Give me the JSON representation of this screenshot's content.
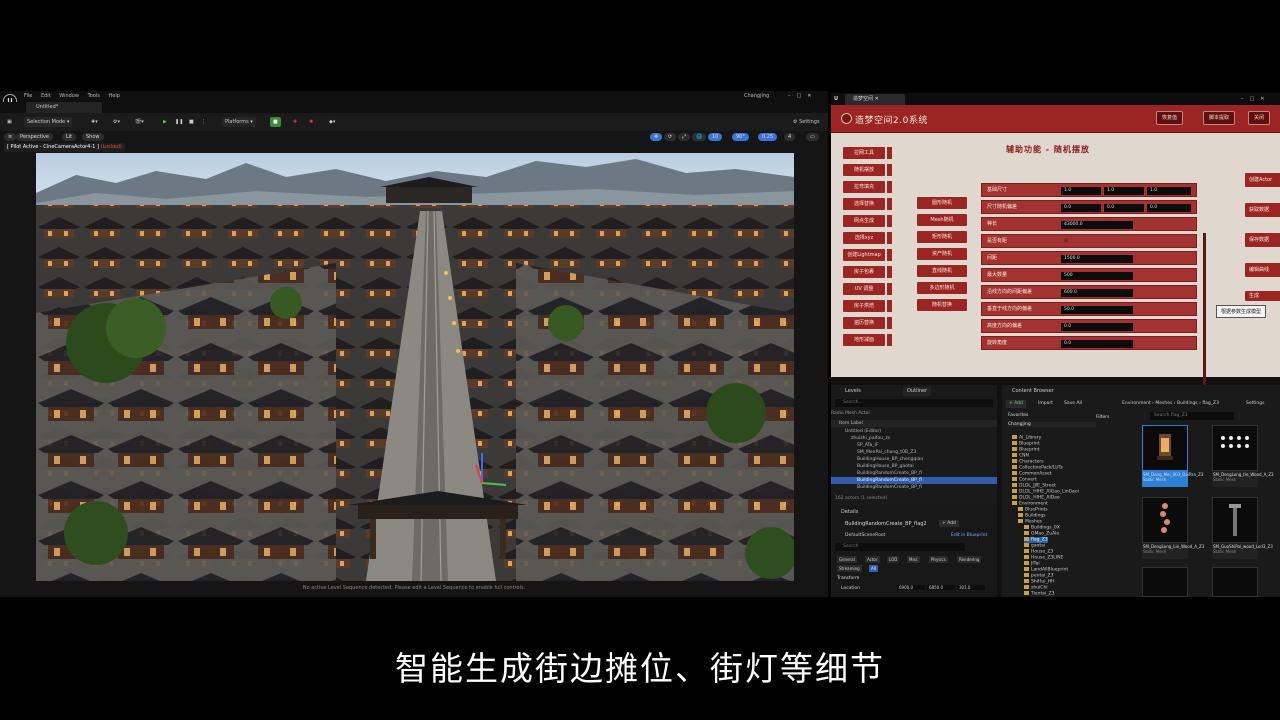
{
  "ue": {
    "menus": [
      "File",
      "Edit",
      "Window",
      "Tools",
      "Help"
    ],
    "project": "Changjing",
    "doc_tab": "Untitled*",
    "toolbar": {
      "selection_mode": "Selection Mode",
      "platforms": "Platforms",
      "settings": "Settings"
    },
    "viewport_bar": {
      "perspective": "Perspective",
      "lit": "Lit",
      "show": "Show",
      "fov": "90°",
      "snap": "10",
      "scale": "0.25",
      "cam": "4"
    },
    "pilot": "[ Pilot Active - CineCameraActor4-1 ]",
    "pilot_locked": "(Locked)",
    "status": "No active Level Sequence detected. Please edit a Level Sequence to enable full controls."
  },
  "tool": {
    "tab": "造梦空间",
    "title": "造梦空间2.0系统",
    "header_buttons": [
      "恢复值",
      "脚本提取",
      "关闭"
    ],
    "subtitle": "辅助功能 - 随机摆放",
    "left_menu": [
      "拉网工具",
      "随机摆放",
      "拉弯填充",
      "选择替换",
      "网点生成",
      "选择xyz",
      "创建Lightmap",
      "房子包裹",
      "UV 调整",
      "房子烘焙",
      "遍历替换",
      "地形减面"
    ],
    "mid_menu": [
      "圆形随机",
      "Mesh随机",
      "矩形随机",
      "资产随机",
      "直线随机",
      "多边形随机",
      "随机替换"
    ],
    "params": [
      {
        "label": "基础尺寸",
        "values": [
          "1.0",
          "1.0",
          "1.0"
        ]
      },
      {
        "label": "尺寸随机偏差",
        "values": [
          "0.0",
          "0.0",
          "0.0"
        ]
      },
      {
        "label": "种长",
        "values": [
          "43000.0"
        ]
      },
      {
        "label": "是否有距",
        "values": [
          "☒"
        ]
      },
      {
        "label": "间距",
        "values": [
          "1500.0"
        ]
      },
      {
        "label": "最大数量",
        "values": [
          "500"
        ]
      },
      {
        "label": "沿线方向的间距偏差",
        "values": [
          "600.0"
        ]
      },
      {
        "label": "垂直于线方向的偏差",
        "values": [
          "50.0"
        ]
      },
      {
        "label": "高度方向的偏差",
        "values": [
          "0.0"
        ]
      },
      {
        "label": "旋转角度",
        "values": [
          "0.0"
        ]
      }
    ],
    "right_buttons": [
      "创建Actor",
      "获取数据",
      "保存数据",
      "编辑曲线",
      "生成"
    ],
    "tooltip": "根据参数生成模型"
  },
  "levels": {
    "tabs": [
      "Levels",
      "Outliner"
    ],
    "search": "Search...",
    "rows": [
      "Radio Mesh Actor",
      "Item Label",
      "Untitled (Editor)",
      "zhuizhi_paifou_zs",
      "SP_ATa_IF",
      "SM_MenPai_chang_t0B_Z3",
      "BuildingHouse_BP_chengqian",
      "BuildingHouse_BP_gaotai",
      "BuildingRandomCreate_BP_fl",
      "BuildingRandomCreate_BP_fl",
      "BuildingRandomCreate_BP_fl"
    ],
    "count": "162 actors (1 selected)",
    "details_tab": "Details",
    "details_title": "BuildingRandomCreate_BP_flag2",
    "add": "+ Add",
    "root": "DefaultSceneRoot",
    "edit_bp": "Edit in Blueprint",
    "search2": "Search",
    "filters": [
      "General",
      "Actor",
      "LOD",
      "Misc",
      "Physics",
      "Rendering",
      "Streaming",
      "All"
    ],
    "transform": "Transform",
    "location_label": "Location",
    "location": [
      "6900.0",
      "6850.0",
      "301.0"
    ]
  },
  "content": {
    "tab": "Content Browser",
    "add": "+ Add",
    "import": "Import",
    "save_all": "Save All",
    "path": [
      "Environment",
      "Meshes",
      "Buildings",
      "flag_Z3"
    ],
    "settings": "Settings",
    "search": "Search flag_Z3",
    "tree_header": "Favorites",
    "tree_root": "Changjing",
    "folders": [
      "Ai_Library",
      "Blueprint",
      "Blueprint",
      "CNN",
      "Characters",
      "CollectivePack/LUTs",
      "CommonAsset",
      "Convert",
      "DLDL_JJIE_Street",
      "DLDL_HIHE_AlGao_LinGaoi",
      "DLDL_HIHE_AlDao",
      "Environment",
      "BluePrints",
      "Buildings",
      "Meshes",
      "Buildings_0X",
      "GMao_ZuAle",
      "flag_Z3",
      "gaotai",
      "House_Z3",
      "House_Z3LINE",
      "JITai",
      "LandAllBlueprint",
      "pentai_Z3",
      "ShiHui_HH",
      "shuiChi",
      "Tientai_Z3"
    ],
    "filters_label": "Filters",
    "assets": [
      {
        "name": "SM_Deng_Mei_003_DaiPan_Z3",
        "type": "Static Mesh"
      },
      {
        "name": "SM_DengLong_tie_Wood_A_Z3",
        "type": "Static Mesh"
      },
      {
        "name": "SM_DengLong_Lie_Wood_A_Z3",
        "type": "Static Mesh"
      },
      {
        "name": "SM_GuoShiPai_wood_Lod3_Z3",
        "type": "Static Mesh"
      }
    ]
  },
  "subtitle": "智能生成街边摊位、街灯等细节"
}
